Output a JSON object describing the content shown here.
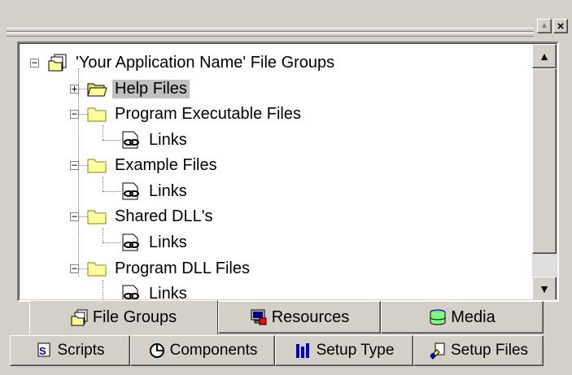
{
  "window": {
    "restore_label": "▲",
    "close_label": "×"
  },
  "tree": {
    "items": [
      {
        "label": "'Your Application Name' File Groups",
        "icon": "file-groups-icon",
        "expander": "−"
      },
      {
        "label": "Help Files",
        "icon": "folder-open-icon",
        "expander": "+"
      },
      {
        "label": "Program Executable Files",
        "icon": "folder-icon",
        "expander": "−"
      },
      {
        "label": "Links",
        "icon": "links-icon"
      },
      {
        "label": "Example Files",
        "icon": "folder-icon",
        "expander": "−"
      },
      {
        "label": "Links",
        "icon": "links-icon"
      },
      {
        "label": "Shared DLL's",
        "icon": "folder-icon",
        "expander": "−"
      },
      {
        "label": "Links",
        "icon": "links-icon"
      },
      {
        "label": "Program DLL Files",
        "icon": "folder-icon",
        "expander": "−"
      },
      {
        "label": "Links",
        "icon": "links-icon"
      }
    ],
    "selected_index": 1
  },
  "scrollbar": {
    "up_label": "▲",
    "down_label": "▼"
  },
  "tabs_top": [
    {
      "label": "File Groups",
      "icon": "file-groups-icon",
      "active": true
    },
    {
      "label": "Resources",
      "icon": "resources-icon"
    },
    {
      "label": "Media",
      "icon": "media-icon"
    }
  ],
  "tabs_bottom": [
    {
      "label": "Scripts",
      "icon": "scripts-icon"
    },
    {
      "label": "Components",
      "icon": "components-icon"
    },
    {
      "label": "Setup Type",
      "icon": "setup-type-icon"
    },
    {
      "label": "Setup Files",
      "icon": "setup-files-icon"
    }
  ],
  "colors": {
    "folder": "#ffff99",
    "selection": "#c0c0c0",
    "face": "#d4d0c8"
  }
}
